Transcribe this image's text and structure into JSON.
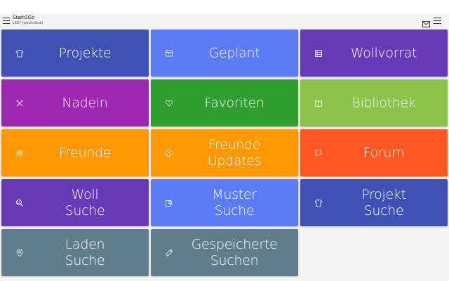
{
  "app": {
    "title": "Stash2Go",
    "version": "v207 (woolrollout)"
  },
  "header_icons": [
    "hamburger-icon",
    "mail-icon",
    "menu-icon"
  ],
  "colors": {
    "blue_dark": "#3f51b5",
    "blue": "#5c7cf5",
    "purple": "#673ab7",
    "magenta": "#9c27b0",
    "green": "#2e9e2e",
    "light_green": "#8bc34a",
    "orange": "#ff9800",
    "deep_orange": "#ff5722",
    "slate": "#607d8b"
  },
  "tiles": [
    {
      "label": "Projekte",
      "icon": "shirt-icon",
      "color": "#3f51b5"
    },
    {
      "label": "Geplant",
      "icon": "archive-icon",
      "color": "#5c7cf5"
    },
    {
      "label": "Wollvorrat",
      "icon": "list-icon",
      "color": "#673ab7"
    },
    {
      "label": "Nadeln",
      "icon": "needles-icon",
      "color": "#9c27b0"
    },
    {
      "label": "Favoriten",
      "icon": "heart-icon",
      "color": "#2e9e2e"
    },
    {
      "label": "Bibliothek",
      "icon": "book-icon",
      "color": "#8bc34a"
    },
    {
      "label": "Freunde",
      "icon": "friends-icon",
      "color": "#ff9800"
    },
    {
      "label": "Freunde\nUpdates",
      "icon": "clock-icon",
      "color": "#ff9800"
    },
    {
      "label": "Forum",
      "icon": "chat-icon",
      "color": "#ff5722"
    },
    {
      "label": "Woll\nSuche",
      "icon": "yarn-search-icon",
      "color": "#673ab7"
    },
    {
      "label": "Muster\nSuche",
      "icon": "pattern-search-icon",
      "color": "#5c7cf5"
    },
    {
      "label": "Projekt\nSuche",
      "icon": "shirt-icon",
      "color": "#3f51b5"
    },
    {
      "label": "Laden\nSuche",
      "icon": "location-icon",
      "color": "#607d8b"
    },
    {
      "label": "Gespeicherte\nSuchen",
      "icon": "tag-icon",
      "color": "#607d8b"
    }
  ]
}
